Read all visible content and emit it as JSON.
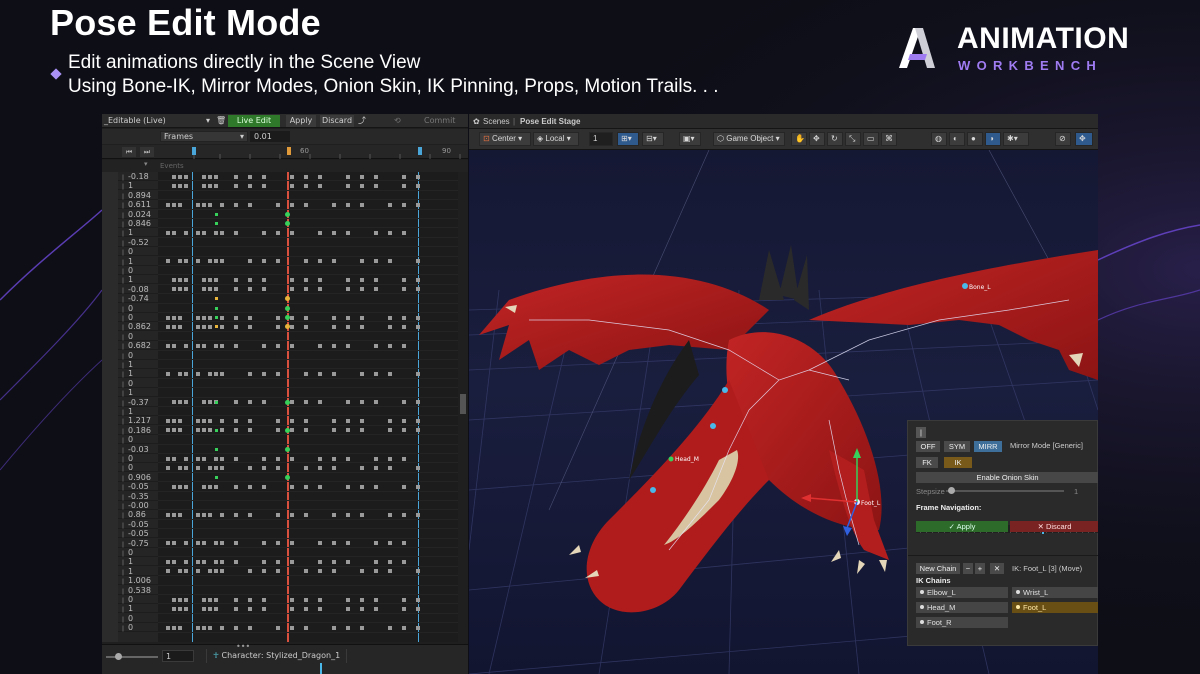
{
  "hero": {
    "title": "Pose Edit Mode",
    "subtitle_line1": "Edit animations directly in the Scene View",
    "subtitle_line2": "Using Bone-IK, Mirror Modes, Onion Skin, IK Pinning, Props, Motion Trails. . ."
  },
  "brand": {
    "name": "ANIMATION",
    "sub": "WORKBENCH",
    "accent": "#a07cf3"
  },
  "timeline": {
    "toolbar": {
      "mode": "_Editable (Live)",
      "live_edit": "Live Edit",
      "apply": "Apply",
      "discard": "Discard",
      "commit": "Commit"
    },
    "frames_dropdown": "Frames",
    "frame_step": "0.01",
    "ruler_labels": [
      "60",
      "90"
    ],
    "events_label": "Events",
    "values": [
      "-0.18",
      "1",
      "0.894",
      "0.611",
      "0.024",
      "0.846",
      "1",
      "-0.52",
      "0",
      "1",
      "0",
      "1",
      "-0.08",
      "-0.74",
      "0",
      "0",
      "0.862",
      "0",
      "0.682",
      "0",
      "1",
      "1",
      "0",
      "1",
      "-0.37",
      "1",
      "1.217",
      "0.186",
      "0",
      "-0.03",
      "0",
      "0",
      "0.906",
      "-0.05",
      "-0.35",
      "-0.00",
      "0.86",
      "-0.05",
      "-0.05",
      "-0.75",
      "0",
      "1",
      "1",
      "1.006",
      "0.538",
      "0",
      "1",
      "0",
      "0"
    ],
    "current_frame": "1",
    "character": "Character: Stylized_Dragon_1",
    "colors": {
      "live": "#2f7a2a",
      "playhead": "#d9503f",
      "marker": "#4aa6d8"
    }
  },
  "scene": {
    "tab_scenes": "Scenes",
    "tab_stage": "Pose Edit Stage",
    "toolbar": {
      "pivot": "Center",
      "space": "Local",
      "snap_value": "1",
      "game_object": "Game Object"
    },
    "bone_labels": {
      "bone_l": "Bone_L",
      "head": "Head_M",
      "foot": "Foot_L"
    },
    "overlay": {
      "mirror": {
        "off": "OFF",
        "sym": "SYM",
        "mirr": "MIRR",
        "mode_label": "Mirror Mode  [Generic]"
      },
      "fk": "FK",
      "ik": "IK",
      "onion": "Enable Onion Skin",
      "stepsize_label": "Stepsize",
      "stepsize_value": "1",
      "frame_nav_label": "Frame Navigation:",
      "apply": "✓ Apply",
      "discard": "✕ Discard",
      "new_chain": "New Chain",
      "minus": "−",
      "plus": "+",
      "close": "✕",
      "ik_info": "IK: Foot_L [3] (Move)",
      "chains_label": "IK Chains",
      "chains": [
        "Elbow_L",
        "Wrist_L",
        "Head_M",
        "Foot_L",
        "Foot_R"
      ]
    }
  }
}
